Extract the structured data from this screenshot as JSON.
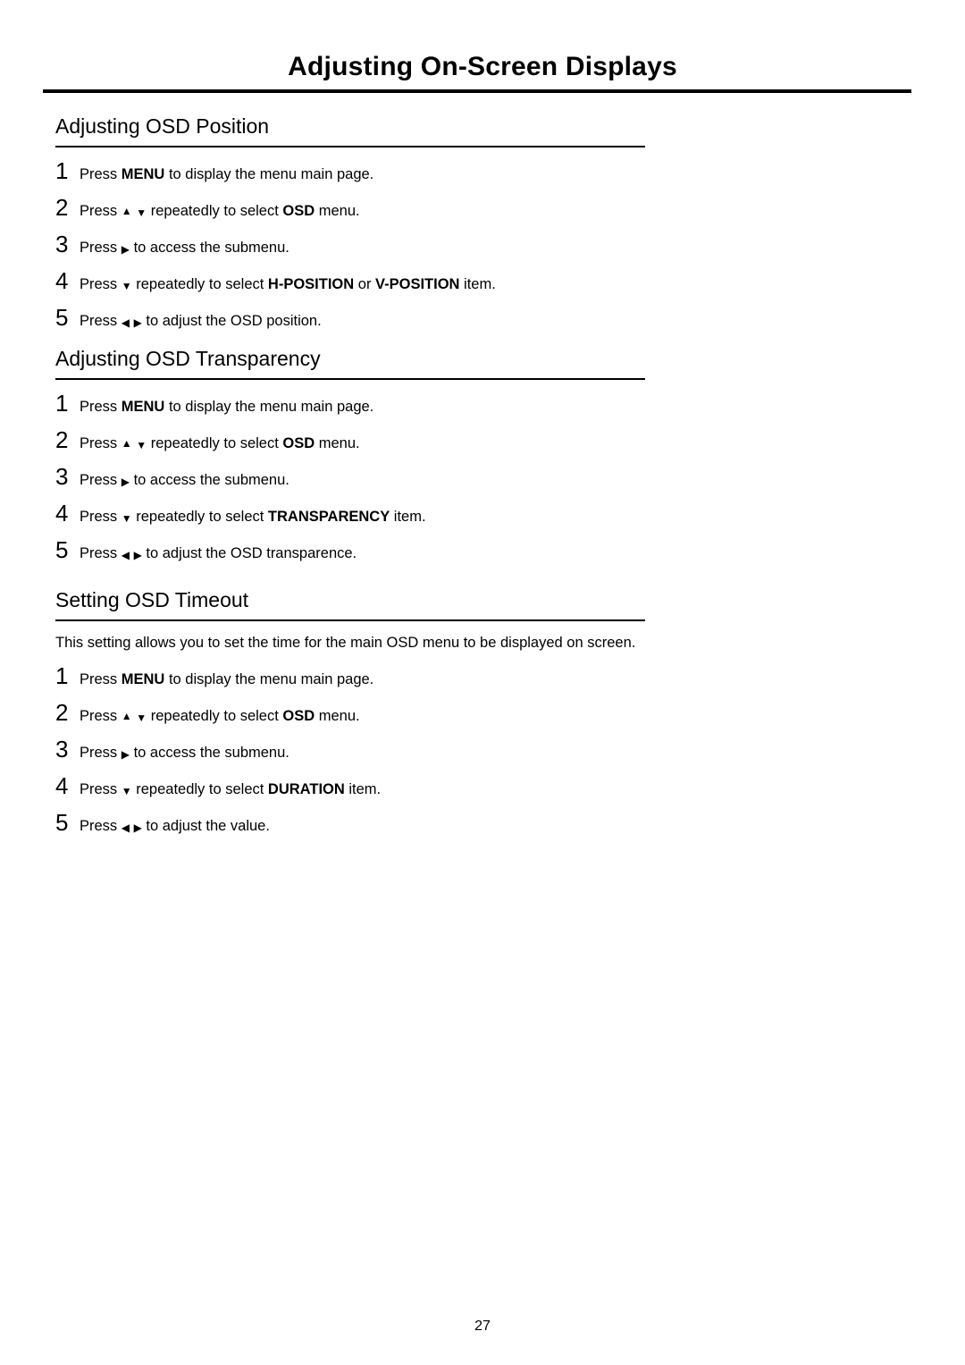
{
  "header": {
    "title": "Adjusting On-Screen Displays"
  },
  "sections": [
    {
      "title": "Adjusting OSD Position",
      "intro": "",
      "steps": [
        {
          "num": "1",
          "parts": [
            {
              "t": "Press "
            },
            {
              "t": "MENU",
              "b": true
            },
            {
              "t": " to display the menu main page."
            }
          ]
        },
        {
          "num": "2",
          "parts": [
            {
              "t": "Press "
            },
            {
              "icon": "arrow-up-icon"
            },
            {
              "t": " "
            },
            {
              "icon": "arrow-down-icon"
            },
            {
              "t": " repeatedly to select "
            },
            {
              "t": "OSD",
              "b": true
            },
            {
              "t": " menu."
            }
          ]
        },
        {
          "num": "3",
          "parts": [
            {
              "t": "Press "
            },
            {
              "icon": "arrow-right-icon"
            },
            {
              "t": " to access the submenu."
            }
          ]
        },
        {
          "num": "4",
          "parts": [
            {
              "t": "Press "
            },
            {
              "icon": "arrow-down-icon"
            },
            {
              "t": " repeatedly to select "
            },
            {
              "t": "H-POSITION",
              "b": true
            },
            {
              "t": " or "
            },
            {
              "t": "V-POSITION",
              "b": true
            },
            {
              "t": " item."
            }
          ]
        },
        {
          "num": "5",
          "parts": [
            {
              "t": "Press "
            },
            {
              "icon": "arrow-left-icon"
            },
            {
              "t": " "
            },
            {
              "icon": "arrow-right-icon"
            },
            {
              "t": " to adjust the OSD position."
            }
          ]
        }
      ]
    },
    {
      "title": "Adjusting OSD Transparency",
      "intro": "",
      "steps": [
        {
          "num": "1",
          "parts": [
            {
              "t": "Press "
            },
            {
              "t": "MENU",
              "b": true
            },
            {
              "t": " to display the menu main page."
            }
          ]
        },
        {
          "num": "2",
          "parts": [
            {
              "t": "Press "
            },
            {
              "icon": "arrow-up-icon"
            },
            {
              "t": " "
            },
            {
              "icon": "arrow-down-icon"
            },
            {
              "t": " repeatedly to select "
            },
            {
              "t": "OSD",
              "b": true
            },
            {
              "t": " menu."
            }
          ]
        },
        {
          "num": "3",
          "parts": [
            {
              "t": "Press "
            },
            {
              "icon": "arrow-right-icon"
            },
            {
              "t": " to access the submenu."
            }
          ]
        },
        {
          "num": "4",
          "parts": [
            {
              "t": "Press "
            },
            {
              "icon": "arrow-down-icon"
            },
            {
              "t": " repeatedly to select "
            },
            {
              "t": "TRANSPARENCY",
              "b": true
            },
            {
              "t": " item."
            }
          ]
        },
        {
          "num": "5",
          "parts": [
            {
              "t": "Press "
            },
            {
              "icon": "arrow-left-icon"
            },
            {
              "t": " "
            },
            {
              "icon": "arrow-right-icon"
            },
            {
              "t": " to adjust the OSD transparence."
            }
          ]
        }
      ]
    },
    {
      "title": "Setting OSD Timeout",
      "intro": "This setting allows you to set the time for the main OSD menu to be displayed on screen.",
      "steps": [
        {
          "num": "1",
          "parts": [
            {
              "t": "Press "
            },
            {
              "t": "MENU",
              "b": true
            },
            {
              "t": " to display the menu main page."
            }
          ]
        },
        {
          "num": "2",
          "parts": [
            {
              "t": "Press "
            },
            {
              "icon": "arrow-up-icon"
            },
            {
              "t": " "
            },
            {
              "icon": "arrow-down-icon"
            },
            {
              "t": " repeatedly to select "
            },
            {
              "t": "OSD",
              "b": true
            },
            {
              "t": " menu."
            }
          ]
        },
        {
          "num": "3",
          "parts": [
            {
              "t": "Press "
            },
            {
              "icon": "arrow-right-icon"
            },
            {
              "t": " to access the submenu."
            }
          ]
        },
        {
          "num": "4",
          "parts": [
            {
              "t": "Press "
            },
            {
              "icon": "arrow-down-icon"
            },
            {
              "t": " repeatedly to select "
            },
            {
              "t": "DURATION",
              "b": true
            },
            {
              "t": " item."
            }
          ]
        },
        {
          "num": "5",
          "parts": [
            {
              "t": "Press "
            },
            {
              "icon": "arrow-left-icon"
            },
            {
              "t": " "
            },
            {
              "icon": "arrow-right-icon"
            },
            {
              "t": " to adjust the value."
            }
          ]
        }
      ]
    }
  ],
  "footer": {
    "page_number": "27"
  },
  "icons": {
    "arrow-up-icon": "▲",
    "arrow-down-icon": "▼",
    "arrow-left-icon": "◀",
    "arrow-right-icon": "▶"
  }
}
